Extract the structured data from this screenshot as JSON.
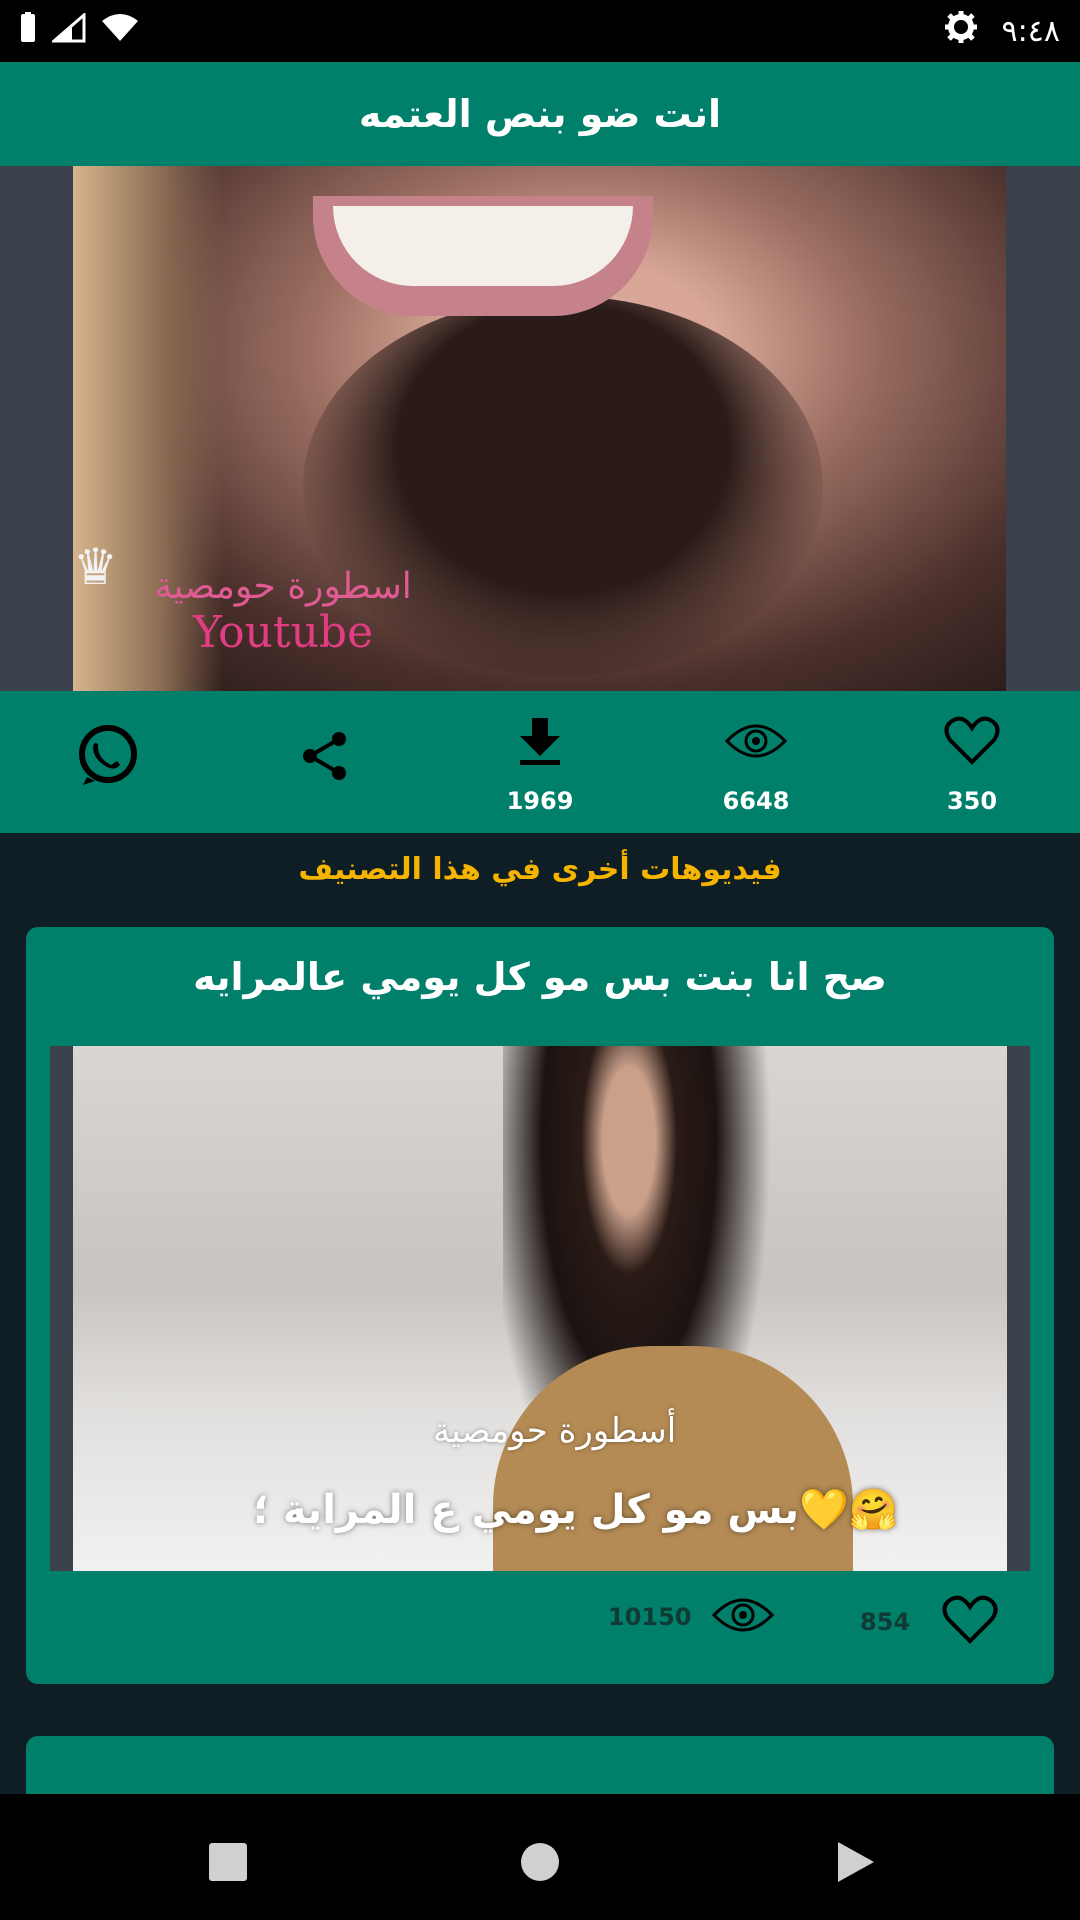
{
  "status_bar": {
    "time": "٩:٤٨",
    "icons": [
      "battery-icon",
      "signal-icon",
      "wifi-icon",
      "settings-icon"
    ]
  },
  "app_bar": {
    "title": "انت ضو بنص العتمه"
  },
  "hero_video": {
    "watermark_arabic": "اسطورة حومصية",
    "watermark_brand": "Youtube"
  },
  "actions": {
    "likes": "350",
    "views": "6648",
    "downloads": "1969",
    "icons": [
      "heart-icon",
      "eye-icon",
      "download-icon",
      "share-icon",
      "whatsapp-icon"
    ]
  },
  "section": {
    "title": "فيديوهات أخرى في هذا التصنيف"
  },
  "videos": [
    {
      "title": "صح انا بنت بس مو كل يومي عالمرايه",
      "watermark": "أسطورة حومصية",
      "caption": "بس مو كل يومي ع المراية ؛💛🤗",
      "likes": "854",
      "views": "10150"
    },
    {
      "title": ""
    }
  ],
  "colors": {
    "primary": "#00806b",
    "accent": "#f5b400",
    "background": "#0f1e24",
    "nav": "#000000"
  }
}
